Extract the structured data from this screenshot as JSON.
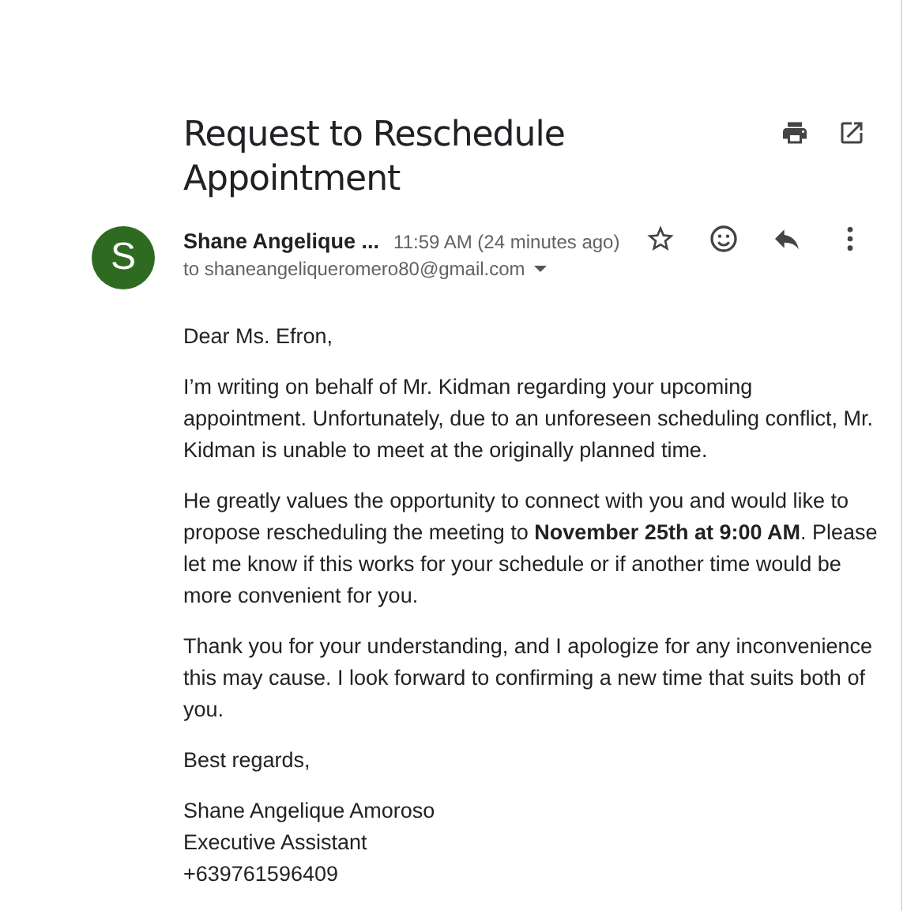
{
  "email": {
    "subject": "Request to Reschedule Appointment",
    "sender": {
      "initial": "S",
      "name": "Shane Angelique ...",
      "time": "11:59 AM (24 minutes ago)",
      "to": "to shaneangeliqueromero80@gmail.com"
    },
    "body": [
      "Dear Ms. Efron,",
      "I’m writing on behalf of Mr. Kidman regarding your upcoming appointment. Unfortunately, due to an unforeseen scheduling conflict, Mr. Kidman is unable to meet at the originally planned time.",
      "He greatly values the opportunity to connect with you and would like to propose rescheduling the meeting to **November 25th at 9:00 AM**. Please let me know if this works for your schedule or if another time would be more convenient for you.",
      "Thank you for your understanding, and I apologize for any inconvenience this may cause. I look forward to confirming a new time that suits both of you.",
      "Best regards,"
    ],
    "signature": [
      "Shane Angelique Amoroso",
      "Executive Assistant",
      "+639761596409"
    ]
  }
}
